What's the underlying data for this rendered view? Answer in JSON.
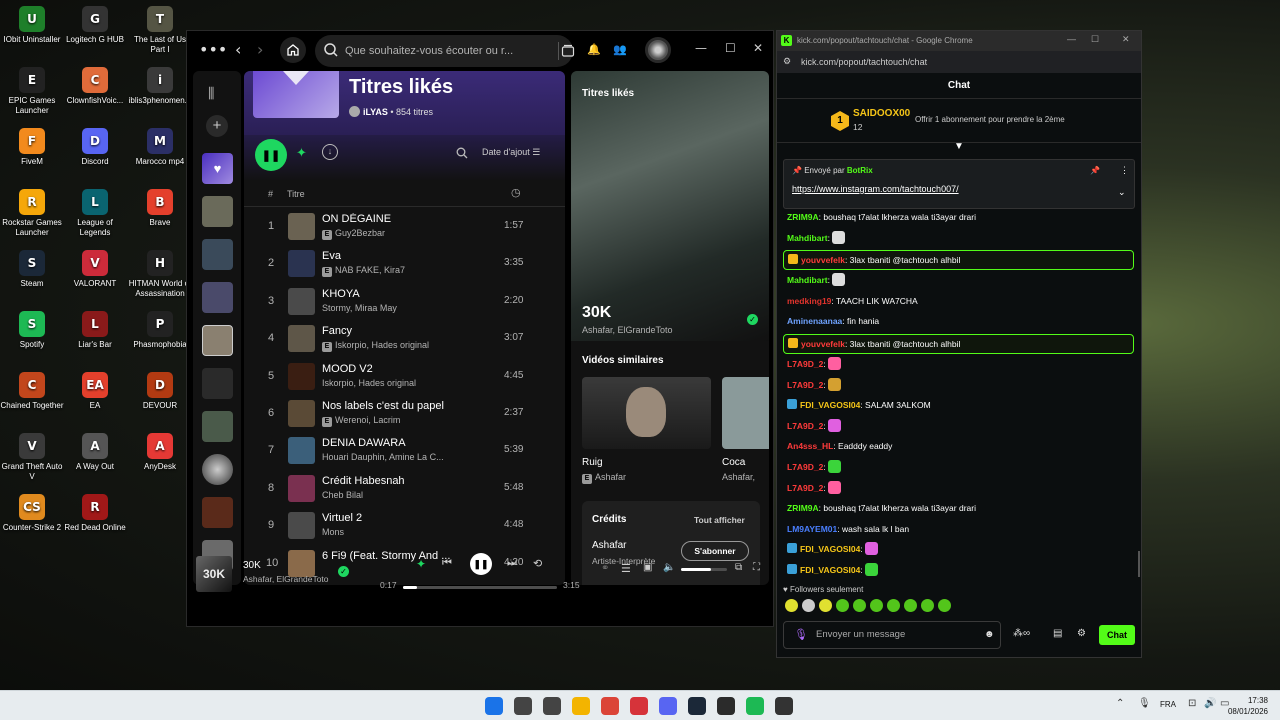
{
  "desktop": {
    "icons": [
      {
        "label": "IObit Uninstaller",
        "color": "#1e7f2a",
        "glyph": "U"
      },
      {
        "label": "Logitech G HUB",
        "color": "#333333",
        "glyph": "G"
      },
      {
        "label": "The Last of Us Part I",
        "color": "#555544",
        "glyph": "T"
      },
      {
        "label": "EPIC Games Launcher",
        "color": "#222222",
        "glyph": "E"
      },
      {
        "label": "ClownfishVoic...",
        "color": "#e06b3a",
        "glyph": "C"
      },
      {
        "label": "iblis3phenomen...",
        "color": "#3a3a3a",
        "glyph": "i"
      },
      {
        "label": "FiveM",
        "color": "#f28a1d",
        "glyph": "F"
      },
      {
        "label": "Discord",
        "color": "#5865f2",
        "glyph": "D"
      },
      {
        "label": "Marocco mp4",
        "color": "#2b2f66",
        "glyph": "M"
      },
      {
        "label": "Rockstar Games Launcher",
        "color": "#f5a70a",
        "glyph": "R"
      },
      {
        "label": "League of Legends",
        "color": "#0a6470",
        "glyph": "L"
      },
      {
        "label": "Brave",
        "color": "#e4402c",
        "glyph": "B"
      },
      {
        "label": "Steam",
        "color": "#1b2838",
        "glyph": "S"
      },
      {
        "label": "VALORANT",
        "color": "#cc2b3a",
        "glyph": "V"
      },
      {
        "label": "HITMAN World of Assassination",
        "color": "#222222",
        "glyph": "H"
      },
      {
        "label": "Spotify",
        "color": "#1db954",
        "glyph": "S"
      },
      {
        "label": "Liar's Bar",
        "color": "#8a1a1a",
        "glyph": "L"
      },
      {
        "label": "Phasmophobia",
        "color": "#222222",
        "glyph": "P"
      },
      {
        "label": "Chained Together",
        "color": "#c2461c",
        "glyph": "C"
      },
      {
        "label": "EA",
        "color": "#e4402c",
        "glyph": "EA"
      },
      {
        "label": "DEVOUR",
        "color": "#b33a12",
        "glyph": "D"
      },
      {
        "label": "Grand Theft Auto V",
        "color": "#3a3a3a",
        "glyph": "V"
      },
      {
        "label": "A Way Out",
        "color": "#555555",
        "glyph": "A"
      },
      {
        "label": "AnyDesk",
        "color": "#e53935",
        "glyph": "A"
      },
      {
        "label": "Counter-Strike 2",
        "color": "#e08a1e",
        "glyph": "CS"
      },
      {
        "label": "Red Dead Online",
        "color": "#a11818",
        "glyph": "R"
      }
    ]
  },
  "spotify": {
    "search_placeholder": "Que souhaitez-vous écouter ou r...",
    "playlist": {
      "title": "Titres likés",
      "owner": "iLYAS",
      "count": "854 titres",
      "sort_label": "Date d'ajout",
      "col_hash": "#",
      "col_title": "Titre"
    },
    "tracks": [
      {
        "n": "1",
        "title": "ON DÉGAINE",
        "artist": "Guy2Bezbar",
        "explicit": true,
        "dur": "1:57",
        "thumb": "#6a6252"
      },
      {
        "n": "2",
        "title": "Eva",
        "artist": "NAB FAKE, Kira7",
        "explicit": true,
        "dur": "3:35",
        "thumb": "#2a3350"
      },
      {
        "n": "3",
        "title": "KHOYA",
        "artist": "Stormy, Miraa May",
        "explicit": false,
        "dur": "2:20",
        "thumb": "#4a4a4a"
      },
      {
        "n": "4",
        "title": "Fancy",
        "artist": "Iskorpio, Hades original",
        "explicit": true,
        "dur": "3:07",
        "thumb": "#5e5648"
      },
      {
        "n": "5",
        "title": "MOOD V2",
        "artist": "Iskorpio, Hades original",
        "explicit": false,
        "dur": "4:45",
        "thumb": "#3a1e12"
      },
      {
        "n": "6",
        "title": "Nos labels c'est du papel",
        "artist": "Werenoi, Lacrim",
        "explicit": true,
        "dur": "2:37",
        "thumb": "#5a4a36"
      },
      {
        "n": "7",
        "title": "DENIA DAWARA",
        "artist": "Houari Dauphin, Amine La C...",
        "explicit": false,
        "dur": "5:39",
        "thumb": "#3b5f7a"
      },
      {
        "n": "8",
        "title": "Crédit Habesnah",
        "artist": "Cheb Bilal",
        "explicit": false,
        "dur": "5:48",
        "thumb": "#7a3050"
      },
      {
        "n": "9",
        "title": "Virtuel 2",
        "artist": "Mons",
        "explicit": false,
        "dur": "4:48",
        "thumb": "#4a4a4a"
      },
      {
        "n": "10",
        "title": "6 Fi9 (Feat. Stormy And ...",
        "artist": "",
        "explicit": false,
        "dur": "4:20",
        "thumb": "#8a6a4a"
      }
    ],
    "right": {
      "title": "Titres likés",
      "song": "30K",
      "artists": "Ashafar, ElGrandeToto",
      "similar_label": "Vidéos similaires",
      "videos": [
        {
          "title": "Ruig",
          "artist": "Ashafar",
          "explicit": true
        },
        {
          "title": "Coca",
          "artist": "Ashafar,",
          "explicit": false
        }
      ],
      "credits_label": "Crédits",
      "show_all": "Tout afficher",
      "credit_name": "Ashafar",
      "credit_role": "Artiste-Interprète",
      "follow": "S'abonner"
    },
    "player": {
      "title": "30K",
      "artists": "Ashafar, ElGrandeToto",
      "elapsed": "0:17",
      "total": "3:15",
      "progress": 0.09
    }
  },
  "chrome": {
    "window_title": "kick.com/popout/tachtouch/chat - Google Chrome",
    "url": "kick.com/popout/tachtouch/chat",
    "chat_title": "Chat",
    "gift": {
      "rank": "1",
      "user": "SAIDOOX00",
      "count": "12",
      "text": "Offrir 1 abonnement pour prendre la 2ème"
    },
    "pinned": {
      "sent_by": "Envoyé par",
      "bot": "BotRix",
      "link": "https://www.instagram.com/tachtouch007/"
    },
    "messages": [
      {
        "user": "ZRIM9A",
        "color": "#53fc18",
        "text": ": boushaq t7alat lkherza wala ti3ayar drari",
        "hl": false,
        "emote": ""
      },
      {
        "user": "Mahdibart",
        "color": "#53fc18",
        "text": ":",
        "hl": false,
        "emote": "#dddddd"
      },
      {
        "user": "youvvefelk",
        "color": "#ff3b3b",
        "text": ": 3lax tbaniti @tachtouch alhbil",
        "hl": true,
        "emote": ""
      },
      {
        "user": "Mahdibart",
        "color": "#53fc18",
        "text": ":",
        "hl": false,
        "emote": "#dddddd"
      },
      {
        "user": "medking19",
        "color": "#e2342d",
        "text": ": TAACH LIK WA7CHA",
        "hl": false,
        "emote": ""
      },
      {
        "user": "Aminenaanaa",
        "color": "#6fa3ff",
        "text": ": fin hania",
        "hl": false,
        "emote": ""
      },
      {
        "user": "youvvefelk",
        "color": "#ff3b3b",
        "text": ": 3lax tbaniti @tachtouch alhbil",
        "hl": true,
        "emote": ""
      },
      {
        "user": "L7A9D_2",
        "color": "#ff3b3b",
        "text": ":",
        "hl": false,
        "emote": "#ff5fa0"
      },
      {
        "user": "L7A9D_2",
        "color": "#ff3b3b",
        "text": ":",
        "hl": false,
        "emote": "#d4a030"
      },
      {
        "user": "FDI_VAGOSI04",
        "color": "#f5c518",
        "text": ": SALAM 3ALKOM",
        "hl": false,
        "emote": ""
      },
      {
        "user": "L7A9D_2",
        "color": "#ff3b3b",
        "text": ":",
        "hl": false,
        "emote": "#e060e0"
      },
      {
        "user": "An4sss_HL",
        "color": "#ff3b3b",
        "text": ": Eadddy eaddy",
        "hl": false,
        "emote": ""
      },
      {
        "user": "L7A9D_2",
        "color": "#ff3b3b",
        "text": ":",
        "hl": false,
        "emote": "#3bd43b"
      },
      {
        "user": "L7A9D_2",
        "color": "#ff3b3b",
        "text": ":",
        "hl": false,
        "emote": "#ff5fa0"
      },
      {
        "user": "ZRIM9A",
        "color": "#53fc18",
        "text": ": boushaq t7alat lkherza wala ti3ayar drari",
        "hl": false,
        "emote": ""
      },
      {
        "user": "LM9AYEM01",
        "color": "#4a7fff",
        "text": ": wash sala lk l ban",
        "hl": false,
        "emote": ""
      },
      {
        "user": "FDI_VAGOSI04",
        "color": "#f5c518",
        "text": ":",
        "hl": false,
        "emote": "#e060e0"
      },
      {
        "user": "FDI_VAGOSI04",
        "color": "#f5c518",
        "text": ":",
        "hl": false,
        "emote": "#3bd43b"
      }
    ],
    "followers_only": "Followers seulement",
    "input_placeholder": "Envoyer un message",
    "send_label": "Chat"
  },
  "taskbar": {
    "lang": "FRA",
    "time": "17:38",
    "date": "08/01/2026",
    "apps": [
      {
        "name": "windows",
        "color": "#1a73e8"
      },
      {
        "name": "search",
        "color": "#444444"
      },
      {
        "name": "task-view",
        "color": "#444444"
      },
      {
        "name": "file-explorer",
        "color": "#f3b400"
      },
      {
        "name": "chrome",
        "color": "#db4437"
      },
      {
        "name": "app-red",
        "color": "#d6333a"
      },
      {
        "name": "discord",
        "color": "#5865f2"
      },
      {
        "name": "steam",
        "color": "#1b2838"
      },
      {
        "name": "app-dark",
        "color": "#2b2b2b"
      },
      {
        "name": "spotify",
        "color": "#1db954"
      },
      {
        "name": "app-black",
        "color": "#333333"
      }
    ]
  }
}
